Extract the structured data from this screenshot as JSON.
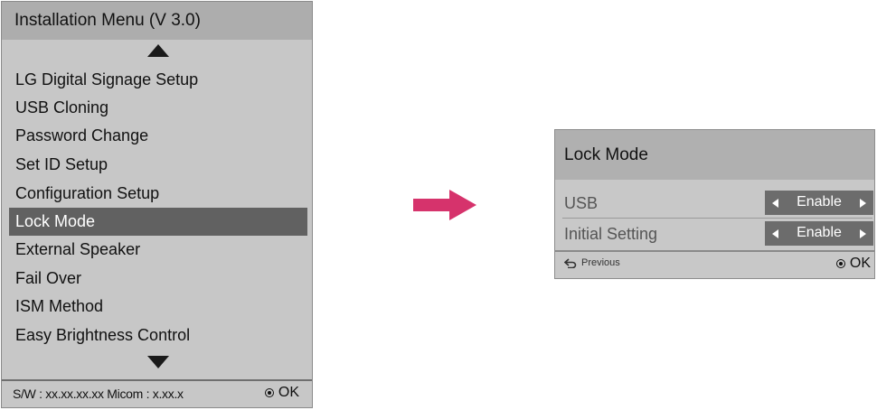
{
  "installation_menu": {
    "title": "Installation Menu (V 3.0)",
    "items": [
      {
        "label": "LG Digital Signage Setup",
        "selected": false
      },
      {
        "label": "USB Cloning",
        "selected": false
      },
      {
        "label": "Password Change",
        "selected": false
      },
      {
        "label": "Set ID Setup",
        "selected": false
      },
      {
        "label": "Configuration Setup",
        "selected": false
      },
      {
        "label": "Lock Mode",
        "selected": true
      },
      {
        "label": "External Speaker",
        "selected": false
      },
      {
        "label": "Fail Over",
        "selected": false
      },
      {
        "label": "ISM Method",
        "selected": false
      },
      {
        "label": "Easy Brightness Control",
        "selected": false
      }
    ],
    "footer": {
      "info": "S/W : xx.xx.xx.xx Micom : x.xx.x",
      "ok_label": "OK"
    }
  },
  "lock_mode_panel": {
    "title": "Lock Mode",
    "settings": [
      {
        "label": "USB",
        "value": "Enable"
      },
      {
        "label": "Initial Setting",
        "value": "Enable"
      }
    ],
    "footer": {
      "previous_label": "Previous",
      "ok_label": "OK"
    }
  },
  "colors": {
    "menu_bg": "#c7c7c7",
    "header_bg": "#adadad",
    "selected_bg": "#616161",
    "value_bg": "#6c6c6c",
    "arrow_pink": "#d6336c"
  },
  "icons": [
    "scroll-up-arrow",
    "scroll-down-arrow",
    "ok-button-icon",
    "previous-return-icon",
    "left-triangle",
    "right-triangle",
    "transition-arrow"
  ]
}
